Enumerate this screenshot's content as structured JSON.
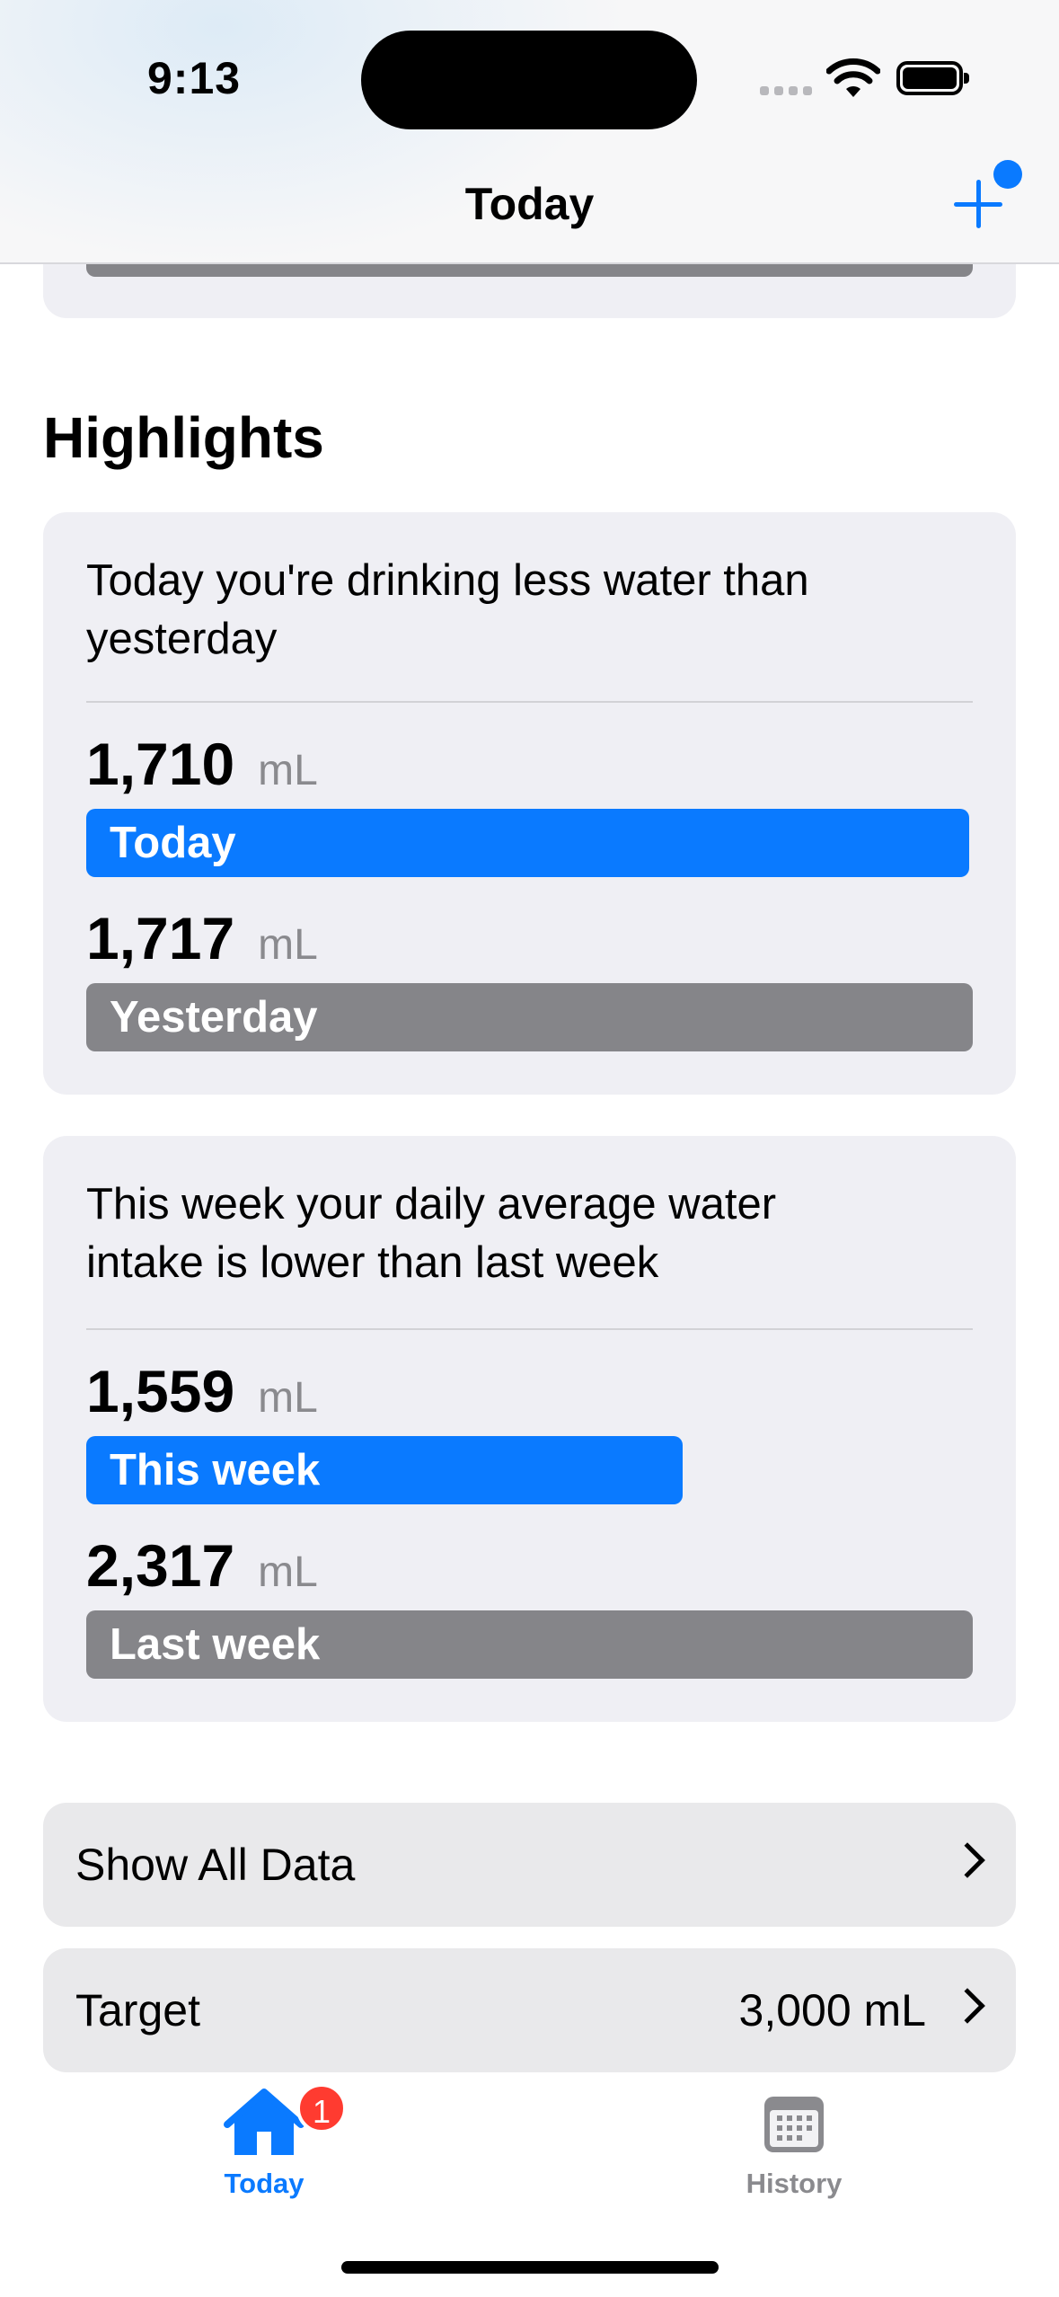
{
  "status_bar": {
    "time": "9:13"
  },
  "nav": {
    "title": "Today",
    "add_icon": "plus-icon"
  },
  "highlights": {
    "section_title": "Highlights",
    "cards": [
      {
        "headline": "Today you're drinking less water than yesterday",
        "rows": [
          {
            "value": "1,710",
            "unit": "mL",
            "bar_label": "Today",
            "bar_color": "#0a7aff",
            "fill_fraction": 0.996
          },
          {
            "value": "1,717",
            "unit": "mL",
            "bar_label": "Yesterday",
            "bar_color": "#858589",
            "fill_fraction": 1.0
          }
        ]
      },
      {
        "headline": "This week your daily average water intake is lower than last week",
        "rows": [
          {
            "value": "1,559",
            "unit": "mL",
            "bar_label": "This week",
            "bar_color": "#0a7aff",
            "fill_fraction": 0.673
          },
          {
            "value": "2,317",
            "unit": "mL",
            "bar_label": "Last week",
            "bar_color": "#858589",
            "fill_fraction": 1.0
          }
        ]
      }
    ]
  },
  "list": {
    "show_all": {
      "label": "Show All Data"
    },
    "target": {
      "label": "Target",
      "value": "3,000 mL"
    }
  },
  "tab_bar": {
    "tabs": [
      {
        "label": "Today",
        "icon": "house-icon",
        "selected": true,
        "badge": "1"
      },
      {
        "label": "History",
        "icon": "calendar-icon",
        "selected": false
      }
    ]
  },
  "colors": {
    "accent": "#0a7aff",
    "gray_bar": "#858589",
    "card_bg": "#efeff4",
    "badge": "#ff3b30"
  }
}
